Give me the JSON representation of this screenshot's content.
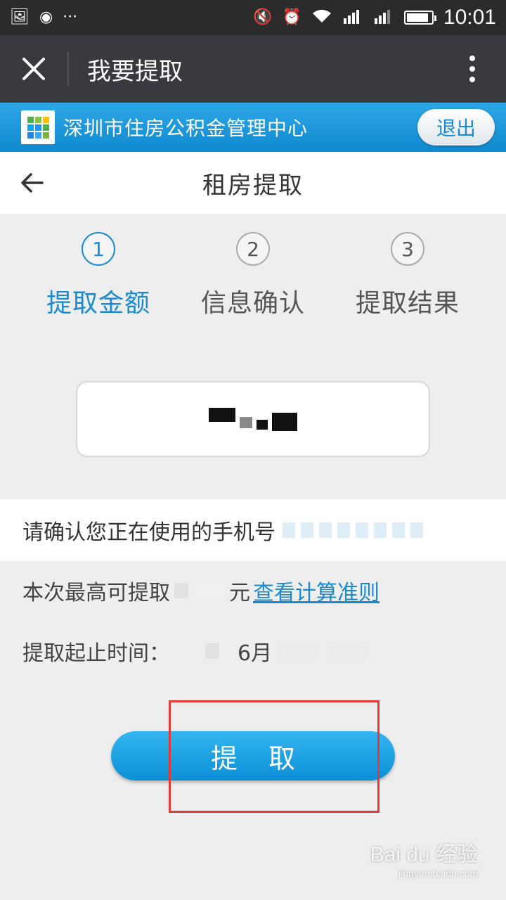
{
  "status_bar": {
    "time": "10:01"
  },
  "title_bar": {
    "title": "我要提取"
  },
  "banner": {
    "org_name": "深圳市住房公积金管理中心",
    "logout_label": "退出"
  },
  "page": {
    "title": "租房提取"
  },
  "steps": [
    {
      "num": "1",
      "label": "提取金额",
      "active": true
    },
    {
      "num": "2",
      "label": "信息确认",
      "active": false
    },
    {
      "num": "3",
      "label": "提取结果",
      "active": false
    }
  ],
  "phone_confirm": {
    "text": "请确认您正在使用的手机号"
  },
  "max_amount": {
    "prefix": "本次最高可提取",
    "unit": "元",
    "link": "查看计算准则"
  },
  "period": {
    "label": "提取起止时间：",
    "month_fragment": "6月"
  },
  "action": {
    "withdraw_label": "提取"
  },
  "watermark": {
    "brand": "Bai du 经验",
    "url": "jingyan.baidu.com"
  },
  "colors": {
    "accent": "#1a8bd0",
    "titlebar": "#393a3f",
    "highlight": "#e53935"
  }
}
